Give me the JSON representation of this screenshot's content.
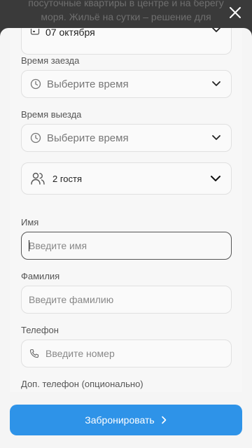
{
  "backdrop": {
    "text": "посуточные квартиры в центре и на берегу моря. Жильё на сутки – решение для туристов,"
  },
  "form": {
    "date_value": "07 октября",
    "checkin_label": "Время заезда",
    "checkin_placeholder": "Выберите время",
    "checkout_label": "Время выезда",
    "checkout_placeholder": "Выберите время",
    "guests_value": "2 гостя",
    "first_name_label": "Имя",
    "first_name_placeholder": "Введите имя",
    "last_name_label": "Фамилия",
    "last_name_placeholder": "Введите фамилию",
    "phone_label": "Телефон",
    "phone_placeholder": "Введите номер",
    "alt_phone_label": "Доп. телефон (опционально)"
  },
  "footer": {
    "book_label": "Забронировать"
  },
  "icons": {
    "close": "close-icon",
    "calendar": "calendar-icon",
    "clock": "clock-icon",
    "chevron": "chevron-down-icon",
    "guests": "users-icon",
    "phone": "phone-icon",
    "arrow": "chevron-right-icon"
  },
  "colors": {
    "accent": "#2e93e8"
  }
}
